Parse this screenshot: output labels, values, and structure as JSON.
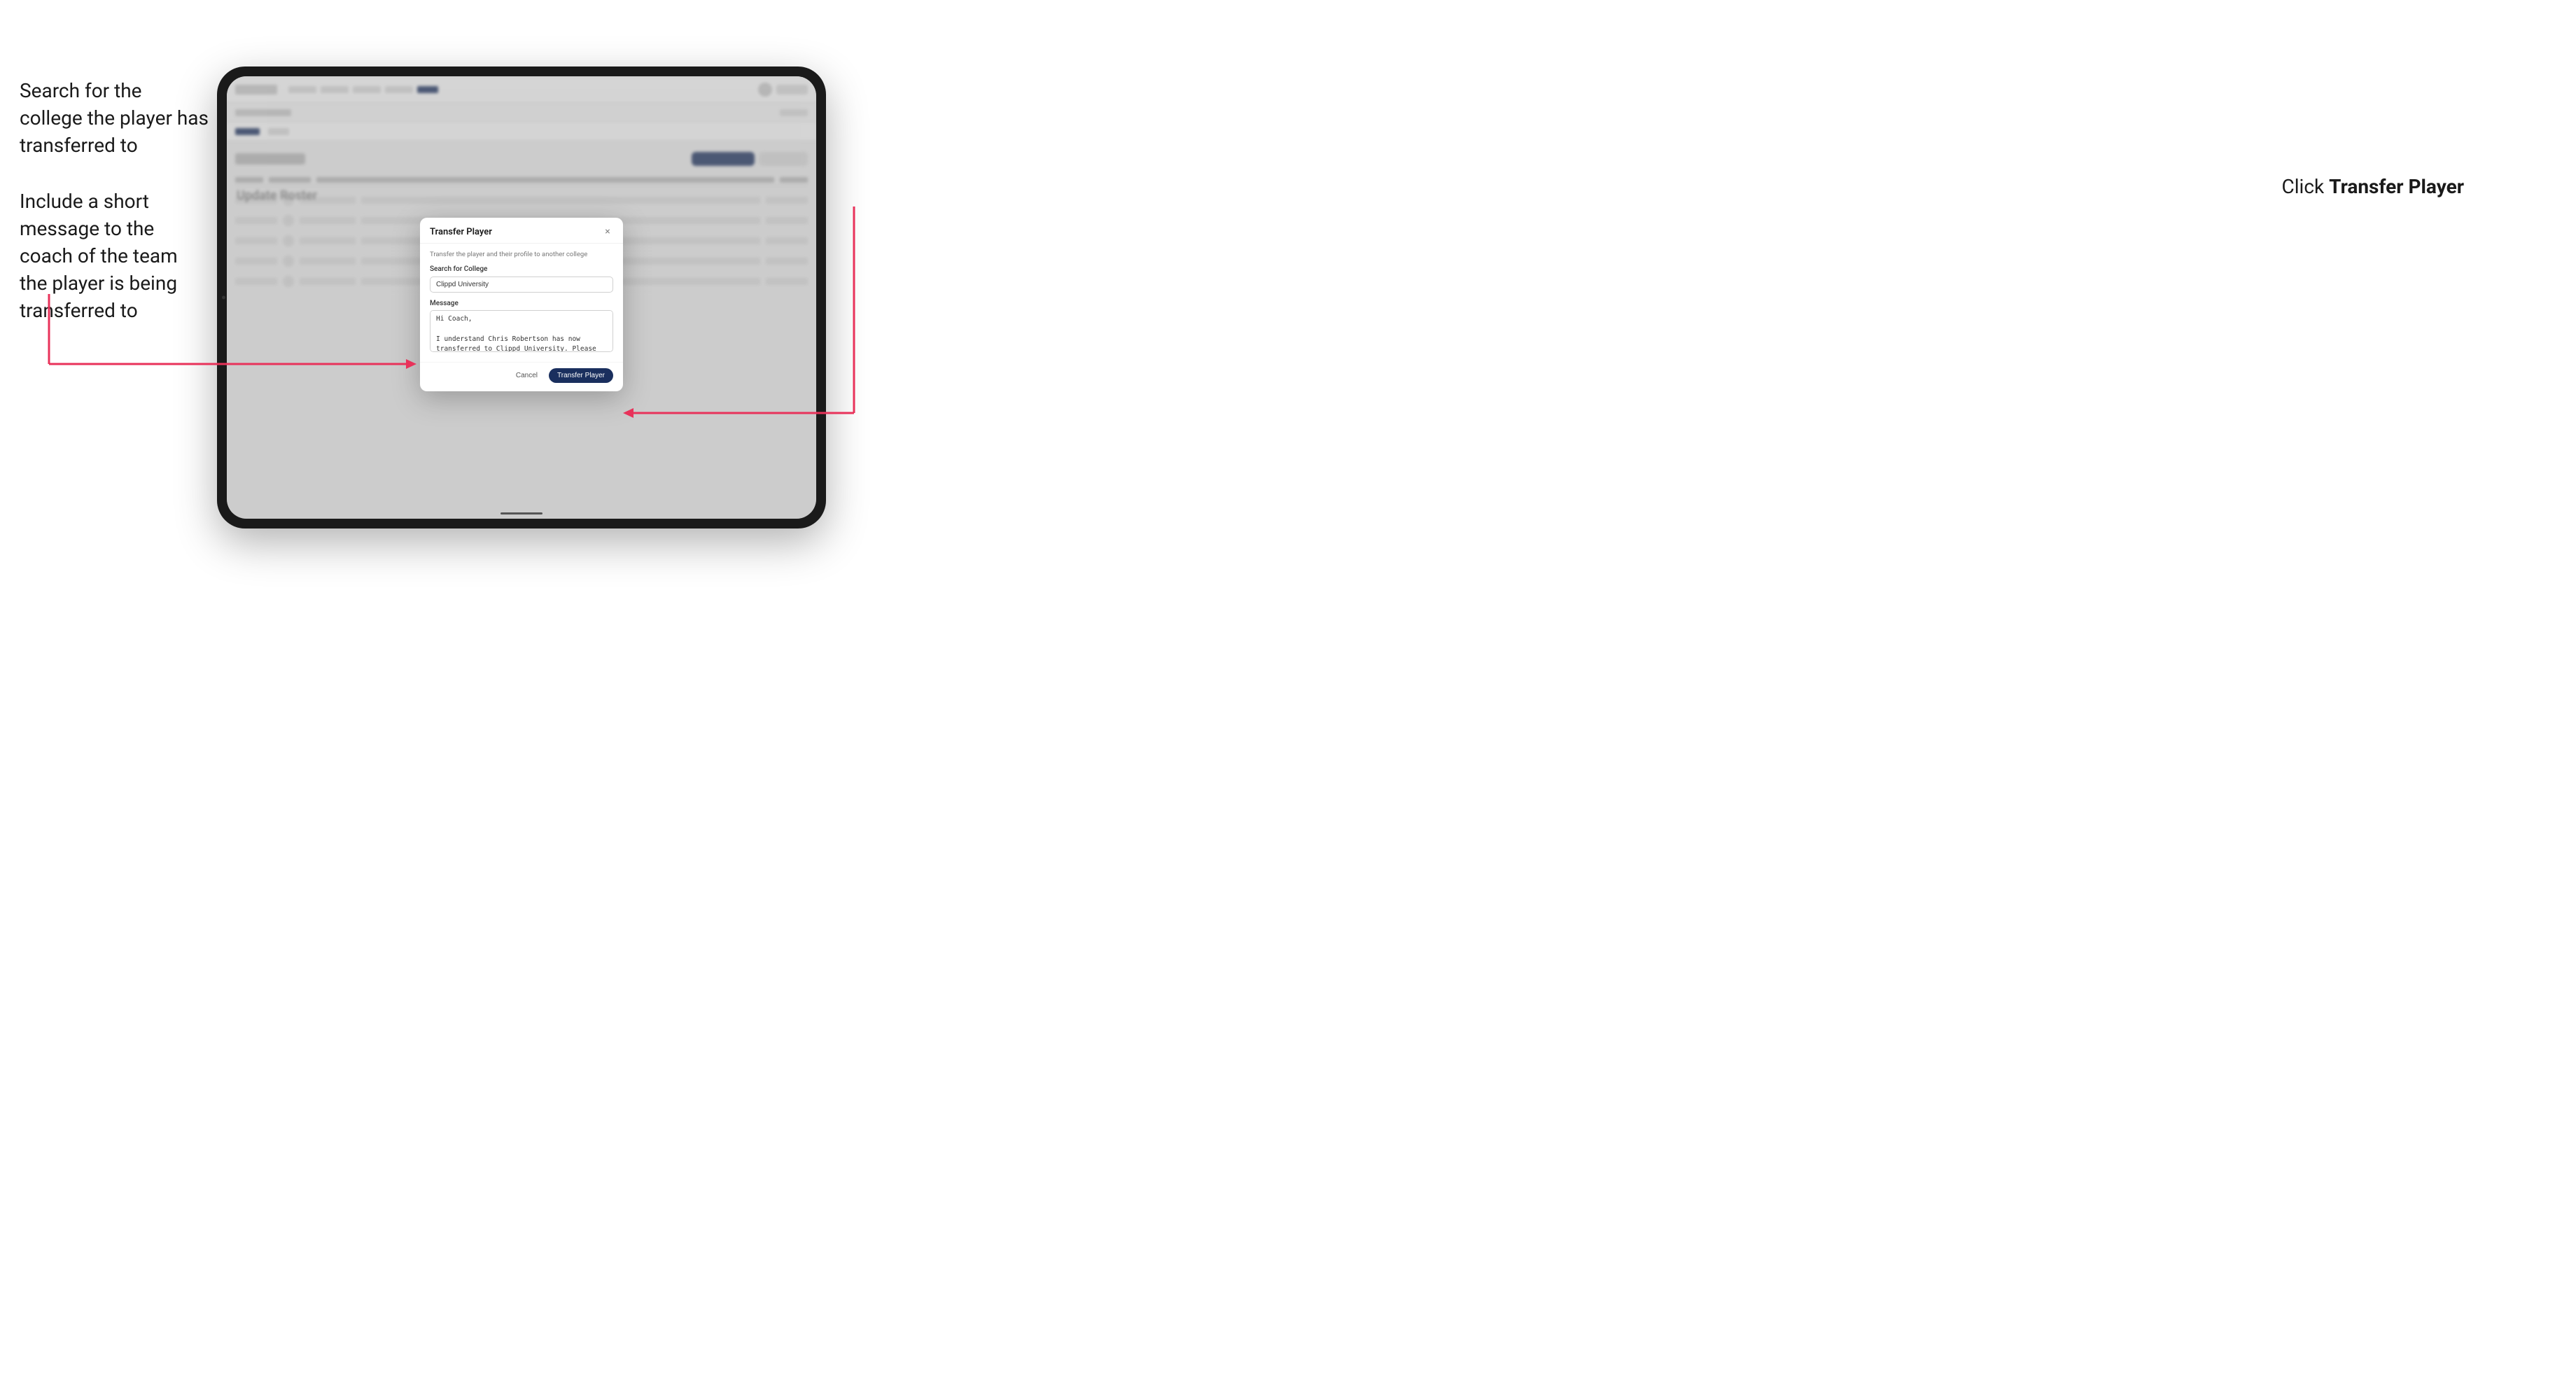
{
  "annotations": {
    "left_text_1": "Search for the college the player has transferred to",
    "left_text_2": "Include a short message to the coach of the team the player is being transferred to",
    "right_text_prefix": "Click ",
    "right_text_bold": "Transfer Player"
  },
  "modal": {
    "title": "Transfer Player",
    "description": "Transfer the player and their profile to another college",
    "search_label": "Search for College",
    "search_value": "Clippd University",
    "message_label": "Message",
    "message_value": "Hi Coach,\n\nI understand Chris Robertson has now transferred to Clippd University. Please accept this transfer request when you can.",
    "cancel_label": "Cancel",
    "transfer_label": "Transfer Player"
  },
  "app": {
    "page_title": "Update Roster"
  }
}
